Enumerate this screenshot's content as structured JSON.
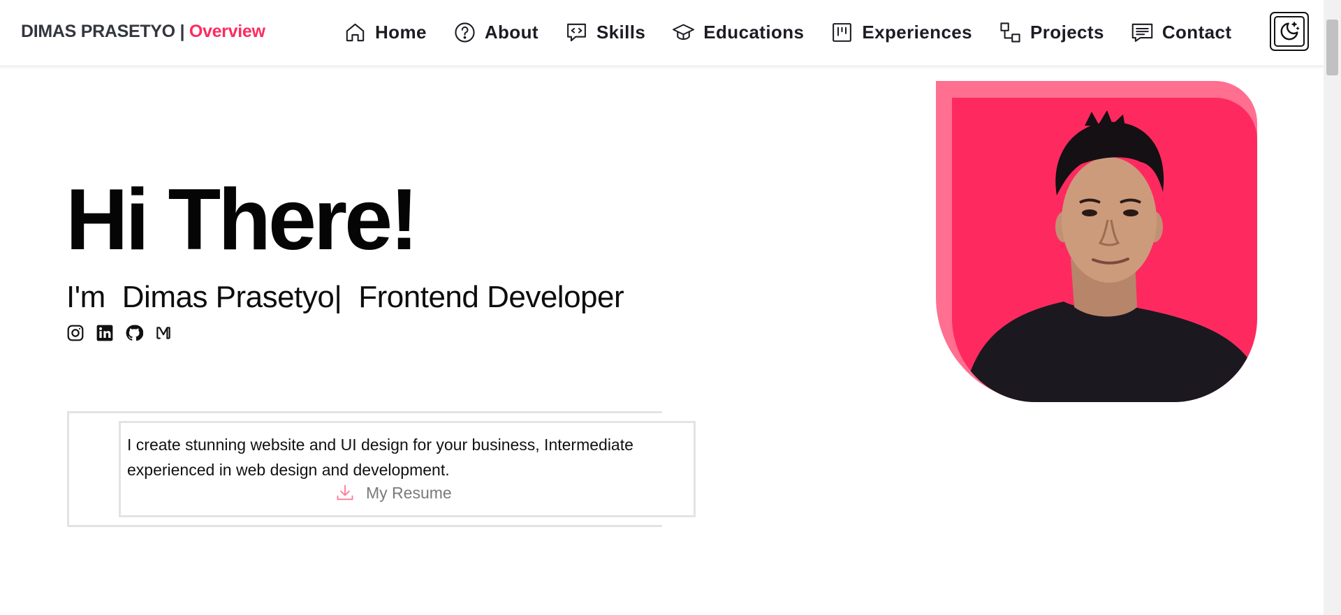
{
  "brand": {
    "name": "DIMAS PRASETYO",
    "separator": " | ",
    "section": "Overview"
  },
  "nav": {
    "items": [
      {
        "label": "Home",
        "icon": "home-icon"
      },
      {
        "label": "About",
        "icon": "question-circle-icon"
      },
      {
        "label": "Skills",
        "icon": "code-bubble-icon"
      },
      {
        "label": "Educations",
        "icon": "graduation-cap-icon"
      },
      {
        "label": "Experiences",
        "icon": "kanban-icon"
      },
      {
        "label": "Projects",
        "icon": "connected-squares-icon"
      },
      {
        "label": "Contact",
        "icon": "message-icon"
      }
    ],
    "theme_toggle_icon": "moon-stars-icon"
  },
  "hero": {
    "title": "Hi There!",
    "greeting": "I'm",
    "name": "Dimas Prasetyo|",
    "role": "Frontend Developer",
    "socials": [
      "instagram-icon",
      "linkedin-icon",
      "github-icon",
      "medium-icon"
    ],
    "intro": "I create stunning website and UI design for your business, Intermediate experienced in web design and development.",
    "resume_label": "My Resume"
  },
  "colors": {
    "accent": "#fe2c5e",
    "accent_light": "#ff6f8f",
    "text": "#0b0b0b"
  }
}
